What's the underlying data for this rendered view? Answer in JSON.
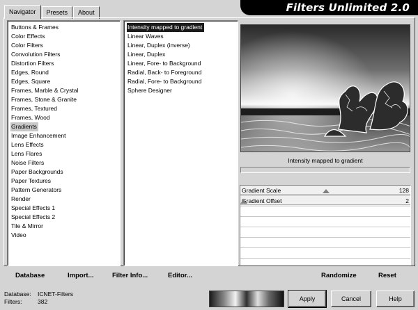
{
  "tabs": [
    {
      "label": "Navigator",
      "active": true
    },
    {
      "label": "Presets",
      "active": false
    },
    {
      "label": "About",
      "active": false
    }
  ],
  "banner": {
    "title": "Filters Unlimited 2.0"
  },
  "categories": {
    "selected": "Gradients",
    "items": [
      "Buttons & Frames",
      "Color Effects",
      "Color Filters",
      "Convolution Filters",
      "Distortion Filters",
      "Edges, Round",
      "Edges, Square",
      "Frames, Marble & Crystal",
      "Frames, Stone & Granite",
      "Frames, Textured",
      "Frames, Wood",
      "Gradients",
      "Image Enhancement",
      "Lens Effects",
      "Lens Flares",
      "Noise Filters",
      "Paper Backgrounds",
      "Paper Textures",
      "Pattern Generators",
      "Render",
      "Special Effects 1",
      "Special Effects 2",
      "Tile & Mirror",
      "Video"
    ]
  },
  "filters": {
    "selected": "Intensity mapped to gradient",
    "items": [
      "Intensity mapped to gradient",
      "Linear Waves",
      "Linear, Duplex (inverse)",
      "Linear, Duplex",
      "Linear, Fore- to Background",
      "Radial, Back- to Foreground",
      "Radial, Fore- to Background",
      "Sphere Designer"
    ]
  },
  "preview": {
    "caption": "Intensity mapped to gradient",
    "progress": 0
  },
  "parameters": [
    {
      "label": "Gradient Scale",
      "value": "128",
      "fraction": 0.5
    },
    {
      "label": "Gradient Offset",
      "value": "2",
      "fraction": 0.0
    }
  ],
  "commands": {
    "database": "Database",
    "import": "Import...",
    "filter_info": "Filter Info...",
    "editor": "Editor...",
    "randomize": "Randomize",
    "reset": "Reset"
  },
  "status": {
    "database_label": "Database:",
    "database_value": "ICNET-Filters",
    "filters_label": "Filters:",
    "filters_value": "382"
  },
  "buttons": {
    "apply": "Apply",
    "cancel": "Cancel",
    "help": "Help"
  },
  "colors": {
    "banner_bg": "#000000",
    "selection_dark": "#1a1a1a",
    "window_bg": "#d4d4d4"
  }
}
